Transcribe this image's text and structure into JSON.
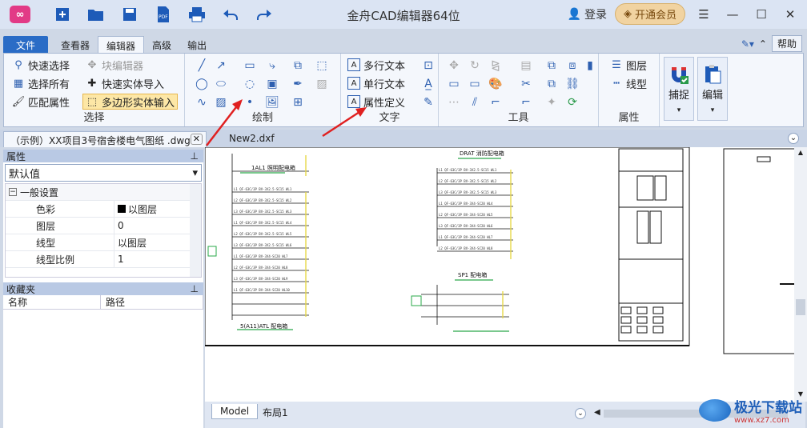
{
  "app": {
    "title": "金舟CAD编辑器64位",
    "login": "登录",
    "vip": "开通会员"
  },
  "tabs": {
    "file": "文件",
    "viewer": "查看器",
    "editor": "编辑器",
    "advanced": "高级",
    "output": "输出",
    "help": "帮助"
  },
  "ribbon": {
    "select": {
      "label": "选择",
      "quick_select": "快速选择",
      "block_editor": "块编辑器",
      "select_all": "选择所有",
      "quick_import": "快速实体导入",
      "match_props": "匹配属性",
      "poly_input": "多边形实体输入"
    },
    "draw": {
      "label": "绘制"
    },
    "text": {
      "label": "文字",
      "mtext": "多行文本",
      "stext": "单行文本",
      "attdef": "属性定义"
    },
    "tools": {
      "label": "工具"
    },
    "props": {
      "label": "属性",
      "layer": "图层",
      "linetype": "线型"
    },
    "snap": "捕捉",
    "edit": "编辑"
  },
  "doc_tabs": [
    "（示例）XX项目3号宿舍楼电气图纸 .dwg",
    "New2.dxf"
  ],
  "properties": {
    "title": "属性",
    "combo": "默认值",
    "category": "一般设置",
    "rows": [
      {
        "k": "色彩",
        "v": "以图层"
      },
      {
        "k": "图层",
        "v": "0"
      },
      {
        "k": "线型",
        "v": "以图层"
      },
      {
        "k": "线型比例",
        "v": "1"
      }
    ]
  },
  "favorites": {
    "title": "收藏夹",
    "col_name": "名称",
    "col_path": "路径"
  },
  "layout_tabs": {
    "model": "Model",
    "layout1": "布局1"
  },
  "watermark": {
    "brand": "极光下载站",
    "url": "www.xz7.com"
  },
  "cad": {
    "labels": [
      "1AL1 照明配电箱",
      "DRAT 消防配电箱",
      "5(A11)ATL 配电箱",
      "SP1 配电箱"
    ]
  }
}
